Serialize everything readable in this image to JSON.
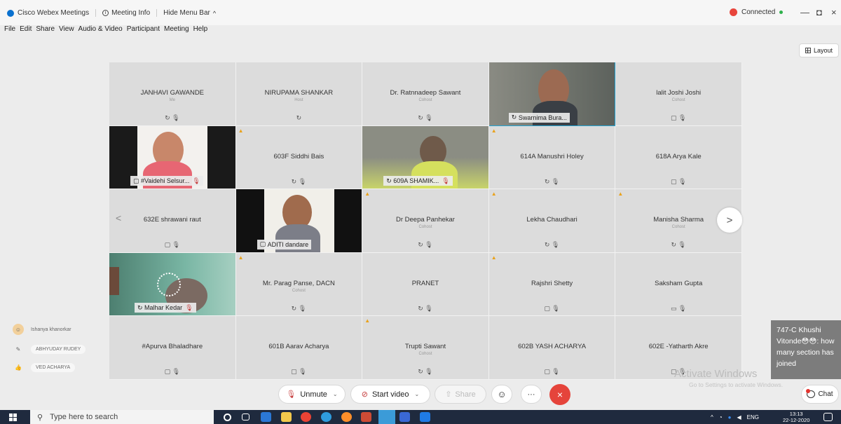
{
  "app": {
    "title": "Cisco Webex Meetings",
    "meeting_info": "Meeting Info",
    "hide_menu": "Hide Menu Bar",
    "status": "Connected",
    "win_controls": [
      "—",
      "◘",
      "×"
    ]
  },
  "menu": [
    "File",
    "Edit",
    "Share",
    "View",
    "Audio & Video",
    "Participant",
    "Meeting",
    "Help"
  ],
  "layout_label": "Layout",
  "tiles": [
    {
      "name": "JANHAVI GAWANDE",
      "role": "Me",
      "icons": "↻ 🎙"
    },
    {
      "name": "NIRUPAMA SHANKAR",
      "role": "Host",
      "icons": "↻"
    },
    {
      "name": "Dr. Ratnnadeep Sawant",
      "role": "Cohost",
      "icons": "↻ 🎙"
    },
    {
      "name": "Swarnima Bura...",
      "video": true,
      "selected": true
    },
    {
      "name": "lalit Joshi Joshi",
      "role": "Cohost",
      "icons": "▢ 🎙"
    },
    {
      "name": "#Vaidehi Selsur...",
      "video": true
    },
    {
      "name": "603F Siddhi Bais",
      "warn": true,
      "icons": "↻ 🎙"
    },
    {
      "name": "609A SHAMIK...",
      "video": true
    },
    {
      "name": "614A Manushri Holey",
      "warn": true,
      "icons": "↻ 🎙"
    },
    {
      "name": "618A Arya Kale",
      "icons": "▢ 🎙"
    },
    {
      "name": "632E shrawani raut",
      "icons": "▢ 🎙"
    },
    {
      "name": "ADITI dandare",
      "video": true
    },
    {
      "name": "Dr Deepa Panhekar",
      "role": "Cohost",
      "warn": true,
      "icons": "↻ 🎙"
    },
    {
      "name": "Lekha Chaudhari",
      "warn": true,
      "icons": "↻ 🎙"
    },
    {
      "name": "Manisha Sharma",
      "role": "Cohost",
      "warn": true,
      "icons": "↻ 🎙"
    },
    {
      "name": "Malhar Kedar",
      "video": true
    },
    {
      "name": "Mr. Parag Panse, DACN",
      "role": "Cohost",
      "warn": true,
      "icons": "↻ 🎙"
    },
    {
      "name": "PRANET",
      "icons": "↻ 🎙"
    },
    {
      "name": "Rajshri Shetty",
      "warn": true,
      "icons": "▢ 🎙"
    },
    {
      "name": "Saksham Gupta",
      "icons": "▭ 🎙"
    },
    {
      "name": "#Apurva Bhaladhare",
      "icons": "▢ 🎙"
    },
    {
      "name": "601B Aarav Acharya",
      "icons": "▢ 🎙"
    },
    {
      "name": "Trupti Sawant",
      "role": "Cohost",
      "warn": true,
      "icons": "↻ 🎙"
    },
    {
      "name": "602B YASH ACHARYA",
      "icons": "▢ 🎙"
    },
    {
      "name": "602E -Yatharth Akre",
      "icons": "▢ 🎙"
    }
  ],
  "side_list": [
    "Ishanya khanorkar",
    "ABHYUDAY RUDEY",
    "VED ACHARYA"
  ],
  "toolbar": {
    "unmute": "Unmute",
    "start_video": "Start video",
    "share": "Share",
    "more": "···",
    "end": "×"
  },
  "chat": {
    "popup": "747-C Khushi Vitonde😳😳: how many section has joined",
    "button": "Chat"
  },
  "watermark": {
    "line1": "Activate Windows",
    "line2": "Go to Settings to activate Windows."
  },
  "taskbar": {
    "search": "Type here to search",
    "lang": "ENG",
    "time": "13:13",
    "date": "22-12-2020"
  }
}
